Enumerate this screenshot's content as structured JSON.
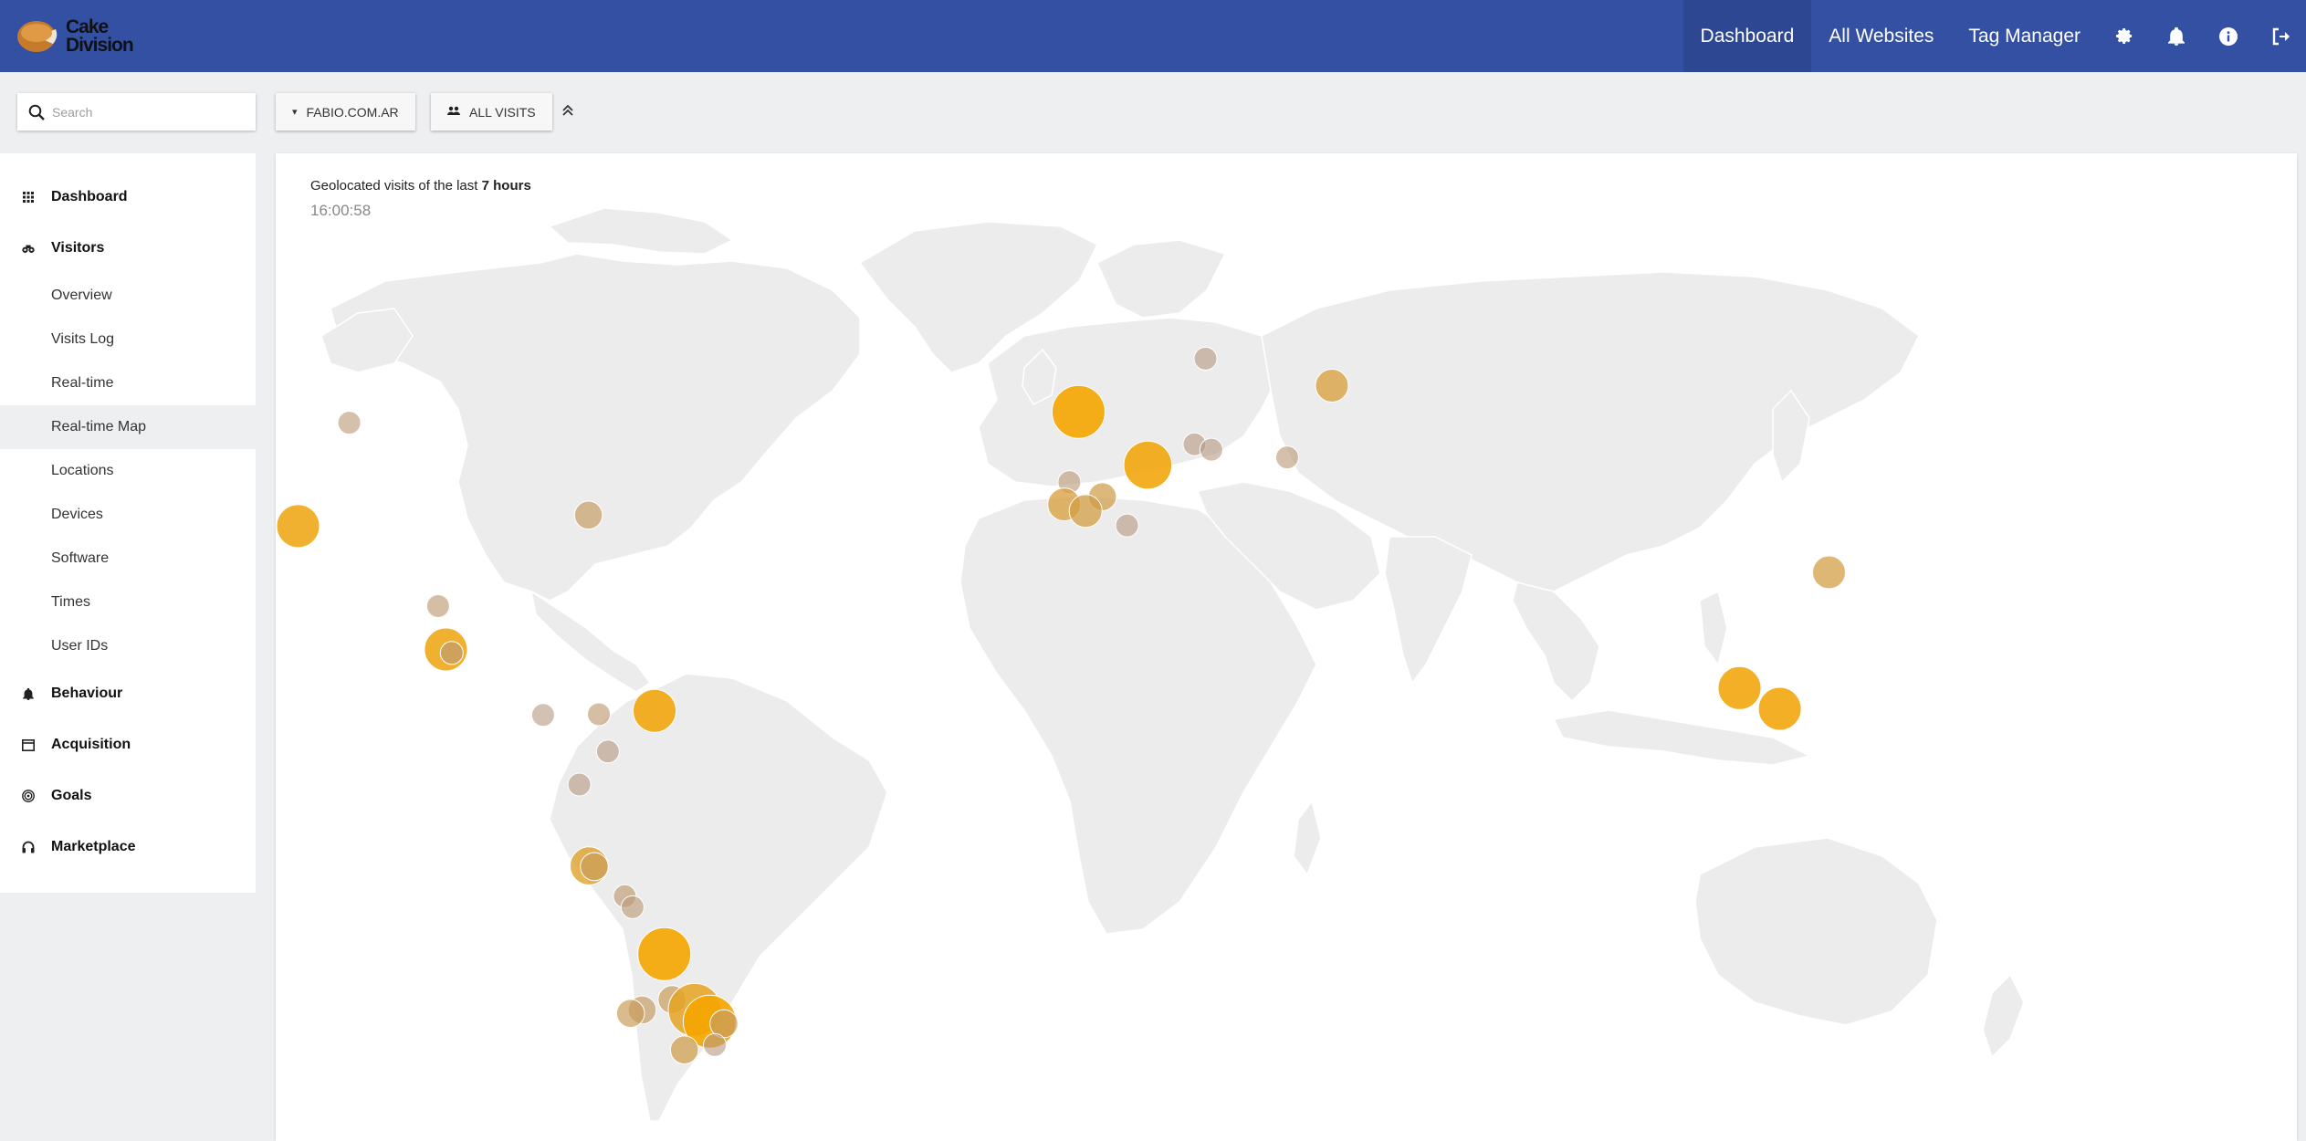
{
  "brand": {
    "name_line1": "Cake",
    "name_line2": "Division",
    "colors": {
      "nav": "#3450a3",
      "nav_active": "#2e4792",
      "marker": "#f5a500"
    }
  },
  "nav": {
    "links": [
      {
        "label": "Dashboard",
        "active": true
      },
      {
        "label": "All Websites",
        "active": false
      },
      {
        "label": "Tag Manager",
        "active": false
      }
    ],
    "icons": [
      "gear-icon",
      "bell-icon",
      "info-icon",
      "logout-icon"
    ]
  },
  "toolbar": {
    "search_placeholder": "Search",
    "site_label": "FABIO.COM.AR",
    "segment_label": "ALL VISITS"
  },
  "sidebar": {
    "dashboard": "Dashboard",
    "visitors": "Visitors",
    "visitor_items": [
      "Overview",
      "Visits Log",
      "Real-time",
      "Real-time Map",
      "Locations",
      "Devices",
      "Software",
      "Times",
      "User IDs"
    ],
    "active_item": "Real-time Map",
    "behaviour": "Behaviour",
    "acquisition": "Acquisition",
    "goals": "Goals",
    "marketplace": "Marketplace"
  },
  "map": {
    "heading_prefix": "Geolocated visits of the last",
    "heading_period": "7 hours",
    "time": "16:00:58",
    "visits": [
      {
        "lat": 37.3,
        "lon": -121.9,
        "size": 3,
        "intensity": 0.9
      },
      {
        "lat": 51.0,
        "lon": -114.0,
        "size": 1,
        "intensity": 0.2
      },
      {
        "lat": 38.9,
        "lon": -77.1,
        "size": 1.5,
        "intensity": 0.35
      },
      {
        "lat": 25.7,
        "lon": -100.3,
        "size": 1,
        "intensity": 0.25
      },
      {
        "lat": 19.4,
        "lon": -99.1,
        "size": 3,
        "intensity": 0.9
      },
      {
        "lat": 18.9,
        "lon": -98.2,
        "size": 1,
        "intensity": 0.2
      },
      {
        "lat": 10.5,
        "lon": -66.9,
        "size": 3,
        "intensity": 0.95
      },
      {
        "lat": 10.0,
        "lon": -75.5,
        "size": 1,
        "intensity": 0.25
      },
      {
        "lat": 9.9,
        "lon": -84.1,
        "size": 1,
        "intensity": 0.15
      },
      {
        "lat": 4.6,
        "lon": -74.1,
        "size": 1,
        "intensity": 0.15
      },
      {
        "lat": -0.2,
        "lon": -78.5,
        "size": 1,
        "intensity": 0.15
      },
      {
        "lat": -12.0,
        "lon": -77.0,
        "size": 2.5,
        "intensity": 0.7
      },
      {
        "lat": -12.1,
        "lon": -76.2,
        "size": 1.5,
        "intensity": 0.4
      },
      {
        "lat": -16.4,
        "lon": -71.5,
        "size": 1,
        "intensity": 0.25
      },
      {
        "lat": -18.0,
        "lon": -70.3,
        "size": 1,
        "intensity": 0.2
      },
      {
        "lat": -24.8,
        "lon": -65.4,
        "size": 4,
        "intensity": 1.0
      },
      {
        "lat": -31.4,
        "lon": -64.2,
        "size": 1.5,
        "intensity": 0.4
      },
      {
        "lat": -32.9,
        "lon": -68.8,
        "size": 1.5,
        "intensity": 0.35
      },
      {
        "lat": -32.9,
        "lon": -60.7,
        "size": 4,
        "intensity": 0.8
      },
      {
        "lat": -34.6,
        "lon": -58.4,
        "size": 4,
        "intensity": 1.0
      },
      {
        "lat": -34.9,
        "lon": -56.2,
        "size": 1.5,
        "intensity": 0.35
      },
      {
        "lat": -38.0,
        "lon": -57.6,
        "size": 1,
        "intensity": 0.15
      },
      {
        "lat": -38.7,
        "lon": -62.3,
        "size": 1.5,
        "intensity": 0.5
      },
      {
        "lat": -33.4,
        "lon": -70.6,
        "size": 1.5,
        "intensity": 0.4
      },
      {
        "lat": 52.4,
        "lon": -1.5,
        "size": 4,
        "intensity": 1.0
      },
      {
        "lat": 45.5,
        "lon": 9.2,
        "size": 3.5,
        "intensity": 0.95
      },
      {
        "lat": 48.2,
        "lon": 16.4,
        "size": 1,
        "intensity": 0.15
      },
      {
        "lat": 47.5,
        "lon": 19.0,
        "size": 1,
        "intensity": 0.15
      },
      {
        "lat": 59.3,
        "lon": 18.1,
        "size": 1,
        "intensity": 0.15
      },
      {
        "lat": 55.8,
        "lon": 37.6,
        "size": 2,
        "intensity": 0.6
      },
      {
        "lat": 46.5,
        "lon": 30.7,
        "size": 1,
        "intensity": 0.2
      },
      {
        "lat": 43.3,
        "lon": -2.9,
        "size": 1,
        "intensity": 0.2
      },
      {
        "lat": 41.4,
        "lon": 2.2,
        "size": 1.5,
        "intensity": 0.5
      },
      {
        "lat": 40.4,
        "lon": -3.7,
        "size": 2,
        "intensity": 0.6
      },
      {
        "lat": 39.5,
        "lon": -0.4,
        "size": 2,
        "intensity": 0.55
      },
      {
        "lat": 37.4,
        "lon": 6.0,
        "size": 1,
        "intensity": 0.15
      },
      {
        "lat": 30.6,
        "lon": 114.3,
        "size": 2,
        "intensity": 0.55
      },
      {
        "lat": 13.8,
        "lon": 100.5,
        "size": 3,
        "intensity": 0.95
      },
      {
        "lat": 10.8,
        "lon": 106.7,
        "size": 3,
        "intensity": 0.95
      }
    ]
  }
}
